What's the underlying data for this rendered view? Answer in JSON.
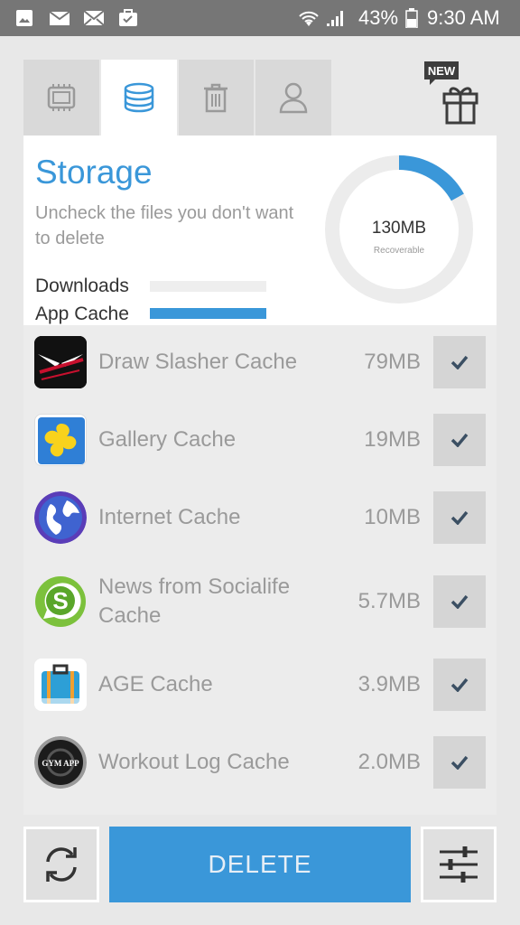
{
  "status_bar": {
    "battery": "43%",
    "time": "9:30 AM",
    "left_icons": [
      "gallery-icon",
      "mail-icon",
      "email-icon",
      "briefcase-icon"
    ],
    "right_icons": [
      "wifi-icon",
      "signal-icon",
      "battery-icon"
    ]
  },
  "tabs": [
    {
      "icon": "chip-icon",
      "active": false
    },
    {
      "icon": "database-icon",
      "active": true
    },
    {
      "icon": "trash-icon",
      "active": false
    },
    {
      "icon": "user-icon",
      "active": false
    }
  ],
  "promo": {
    "badge": "NEW",
    "icon": "gift-icon"
  },
  "storage": {
    "title": "Storage",
    "subtitle": "Uncheck the files you don't want to delete",
    "legend": [
      {
        "label": "Downloads",
        "color": "#eeeeee"
      },
      {
        "label": "App Cache",
        "color": "#3a97d9"
      }
    ],
    "donut": {
      "value": "130MB",
      "label": "Recoverable",
      "fill_fraction": 0.17,
      "track_color": "#ececec",
      "accent": "#3a97d9"
    }
  },
  "items": [
    {
      "name": "Draw Slasher Cache",
      "size": "79MB",
      "checked": true,
      "icon": "draw-slasher-app-icon"
    },
    {
      "name": "Gallery Cache",
      "size": "19MB",
      "checked": true,
      "icon": "gallery-app-icon"
    },
    {
      "name": "Internet Cache",
      "size": "10MB",
      "checked": true,
      "icon": "internet-app-icon"
    },
    {
      "name": "News from Socialife Cache",
      "size": "5.7MB",
      "checked": true,
      "icon": "socialife-app-icon"
    },
    {
      "name": "AGE Cache",
      "size": "3.9MB",
      "checked": true,
      "icon": "age-app-icon"
    },
    {
      "name": "Workout Log Cache",
      "size": "2.0MB",
      "checked": true,
      "icon": "gym-app-icon",
      "icon_text": "GYM APP"
    }
  ],
  "actions": {
    "delete_label": "DELETE",
    "refresh_icon": "refresh-icon",
    "settings_icon": "sliders-icon"
  }
}
